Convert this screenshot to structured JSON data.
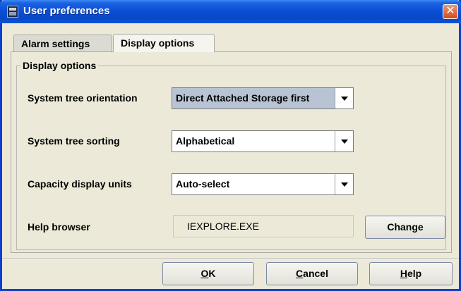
{
  "window": {
    "title": "User preferences"
  },
  "tabs": [
    {
      "label": "Alarm settings",
      "selected": false
    },
    {
      "label": "Display options",
      "selected": true
    }
  ],
  "group": {
    "legend": "Display options"
  },
  "fields": {
    "orientation": {
      "label": "System tree orientation",
      "value": "Direct Attached Storage first"
    },
    "sorting": {
      "label": "System tree sorting",
      "value": "Alphabetical"
    },
    "units": {
      "label": "Capacity display units",
      "value": "Auto-select"
    },
    "browser": {
      "label": "Help browser",
      "value": "IEXPLORE.EXE",
      "change_label": "Change"
    }
  },
  "buttons": {
    "ok": {
      "label": "OK",
      "mnemonic": "O",
      "rest": "K"
    },
    "cancel": {
      "label": "Cancel",
      "mnemonic": "C",
      "rest": "ancel"
    },
    "help": {
      "label": "Help",
      "mnemonic": "H",
      "rest": "elp"
    }
  },
  "colors": {
    "titlebar": "#0a4fd6",
    "close_button": "#d24a1c",
    "selected_combo": "#b8c4d4",
    "window_bg": "#ece9d8"
  },
  "icons": {
    "app": "server-icon",
    "close": "close-icon",
    "dropdown": "chevron-down-icon"
  }
}
